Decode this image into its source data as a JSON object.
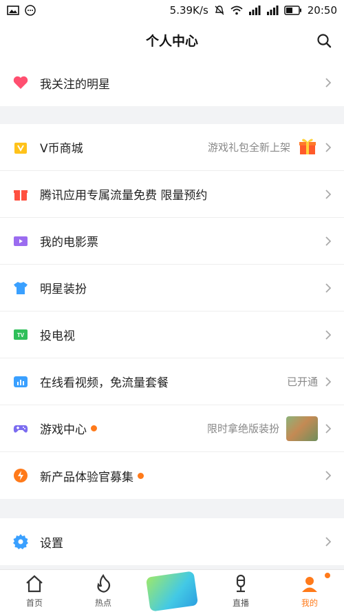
{
  "statusbar": {
    "speed": "5.39K/s",
    "time": "20:50"
  },
  "header": {
    "title": "个人中心"
  },
  "section1": [
    {
      "label": "我关注的明星",
      "icon": "heart-icon",
      "color": "#ff4f70"
    }
  ],
  "section2": [
    {
      "label": "V币商城",
      "right": "游戏礼包全新上架",
      "icon": "v-coin-icon",
      "color": "#ffc21a"
    },
    {
      "label": "腾讯应用专属流量免费 限量预约",
      "right": "",
      "icon": "gift-box-icon",
      "color": "#ff5040"
    },
    {
      "label": "我的电影票",
      "right": "",
      "icon": "movie-ticket-icon",
      "color": "#9b6cf0"
    },
    {
      "label": "明星装扮",
      "right": "",
      "icon": "tshirt-icon",
      "color": "#3aa0ff"
    },
    {
      "label": "投电视",
      "right": "",
      "icon": "tv-icon",
      "color": "#2fbf5a"
    },
    {
      "label": "在线看视频，免流量套餐",
      "right": "已开通",
      "icon": "chart-icon",
      "color": "#3aa0ff"
    },
    {
      "label": "游戏中心",
      "right": "限时拿绝版装扮",
      "icon": "gamepad-icon",
      "color": "#7b6cf0"
    },
    {
      "label": "新产品体验官募集",
      "right": "",
      "icon": "lightning-icon",
      "color": "#ff7a1a"
    }
  ],
  "section3": [
    {
      "label": "设置",
      "icon": "gear-icon",
      "color": "#3aa0ff"
    }
  ],
  "tabs": [
    {
      "label": "首页",
      "icon": "home-icon"
    },
    {
      "label": "热点",
      "icon": "flame-icon"
    },
    {
      "label": "",
      "icon": "promo-banner"
    },
    {
      "label": "直播",
      "icon": "microphone-icon"
    },
    {
      "label": "我的",
      "icon": "profile-icon"
    }
  ],
  "colors": {
    "accent": "#ff7a1a"
  }
}
